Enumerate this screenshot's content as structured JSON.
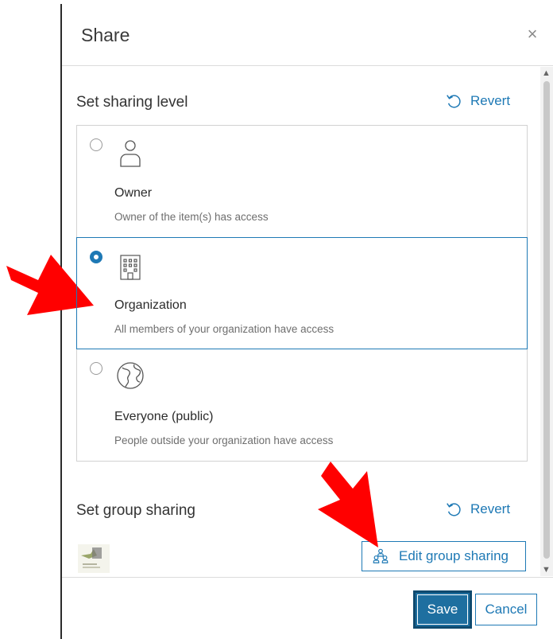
{
  "dialog": {
    "title": "Share",
    "close_icon": "close-icon"
  },
  "sharing_level": {
    "title": "Set sharing level",
    "revert_label": "Revert",
    "selected": "organization",
    "options": [
      {
        "id": "owner",
        "label": "Owner",
        "description": "Owner of the item(s) has access",
        "icon": "user-icon"
      },
      {
        "id": "organization",
        "label": "Organization",
        "description": "All members of your organization have access",
        "icon": "building-icon"
      },
      {
        "id": "everyone",
        "label": "Everyone (public)",
        "description": "People outside your organization have access",
        "icon": "globe-icon"
      }
    ]
  },
  "group_sharing": {
    "title": "Set group sharing",
    "revert_label": "Revert",
    "edit_label": "Edit group sharing"
  },
  "footer": {
    "save_label": "Save",
    "cancel_label": "Cancel"
  },
  "colors": {
    "accent": "#1e79b5",
    "save_bg": "#1e6fa0",
    "annotation_arrow": "#ff0000"
  }
}
